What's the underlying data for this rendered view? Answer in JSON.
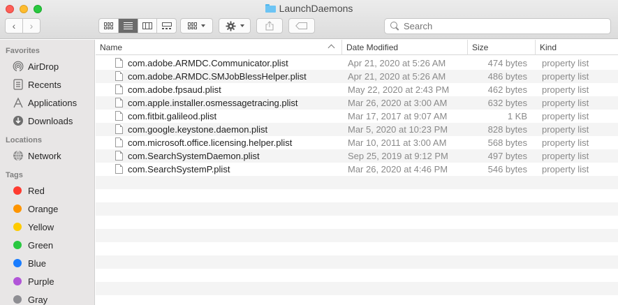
{
  "window": {
    "title": "LaunchDaemons"
  },
  "toolbar": {
    "back": "‹",
    "forward": "›",
    "search_placeholder": "Search"
  },
  "sidebar": {
    "favorites_heading": "Favorites",
    "favorites": [
      {
        "label": "AirDrop",
        "icon": "airdrop-icon"
      },
      {
        "label": "Recents",
        "icon": "recents-icon"
      },
      {
        "label": "Applications",
        "icon": "applications-icon"
      },
      {
        "label": "Downloads",
        "icon": "downloads-icon"
      }
    ],
    "locations_heading": "Locations",
    "locations": [
      {
        "label": "Network",
        "icon": "network-icon"
      }
    ],
    "tags_heading": "Tags",
    "tags": [
      {
        "label": "Red",
        "color": "#fe3b30"
      },
      {
        "label": "Orange",
        "color": "#fe9500"
      },
      {
        "label": "Yellow",
        "color": "#fecb00"
      },
      {
        "label": "Green",
        "color": "#29c840"
      },
      {
        "label": "Blue",
        "color": "#1a7dfe"
      },
      {
        "label": "Purple",
        "color": "#b155d8"
      },
      {
        "label": "Gray",
        "color": "#8e8e93"
      }
    ]
  },
  "columns": {
    "name": "Name",
    "date": "Date Modified",
    "size": "Size",
    "kind": "Kind"
  },
  "files": [
    {
      "name": "com.adobe.ARMDC.Communicator.plist",
      "date": "Apr 21, 2020 at 5:26 AM",
      "size": "474 bytes",
      "kind": "property list"
    },
    {
      "name": "com.adobe.ARMDC.SMJobBlessHelper.plist",
      "date": "Apr 21, 2020 at 5:26 AM",
      "size": "486 bytes",
      "kind": "property list"
    },
    {
      "name": "com.adobe.fpsaud.plist",
      "date": "May 22, 2020 at 2:43 PM",
      "size": "462 bytes",
      "kind": "property list"
    },
    {
      "name": "com.apple.installer.osmessagetracing.plist",
      "date": "Mar 26, 2020 at 3:00 AM",
      "size": "632 bytes",
      "kind": "property list"
    },
    {
      "name": "com.fitbit.galileod.plist",
      "date": "Mar 17, 2017 at 9:07 AM",
      "size": "1 KB",
      "kind": "property list"
    },
    {
      "name": "com.google.keystone.daemon.plist",
      "date": "Mar 5, 2020 at 10:23 PM",
      "size": "828 bytes",
      "kind": "property list"
    },
    {
      "name": "com.microsoft.office.licensing.helper.plist",
      "date": "Mar 10, 2011 at 3:00 AM",
      "size": "568 bytes",
      "kind": "property list"
    },
    {
      "name": "com.SearchSystemDaemon.plist",
      "date": "Sep 25, 2019 at 9:12 PM",
      "size": "497 bytes",
      "kind": "property list"
    },
    {
      "name": "com.SearchSystemP.plist",
      "date": "Mar 26, 2020 at 4:46 PM",
      "size": "546 bytes",
      "kind": "property list"
    }
  ]
}
